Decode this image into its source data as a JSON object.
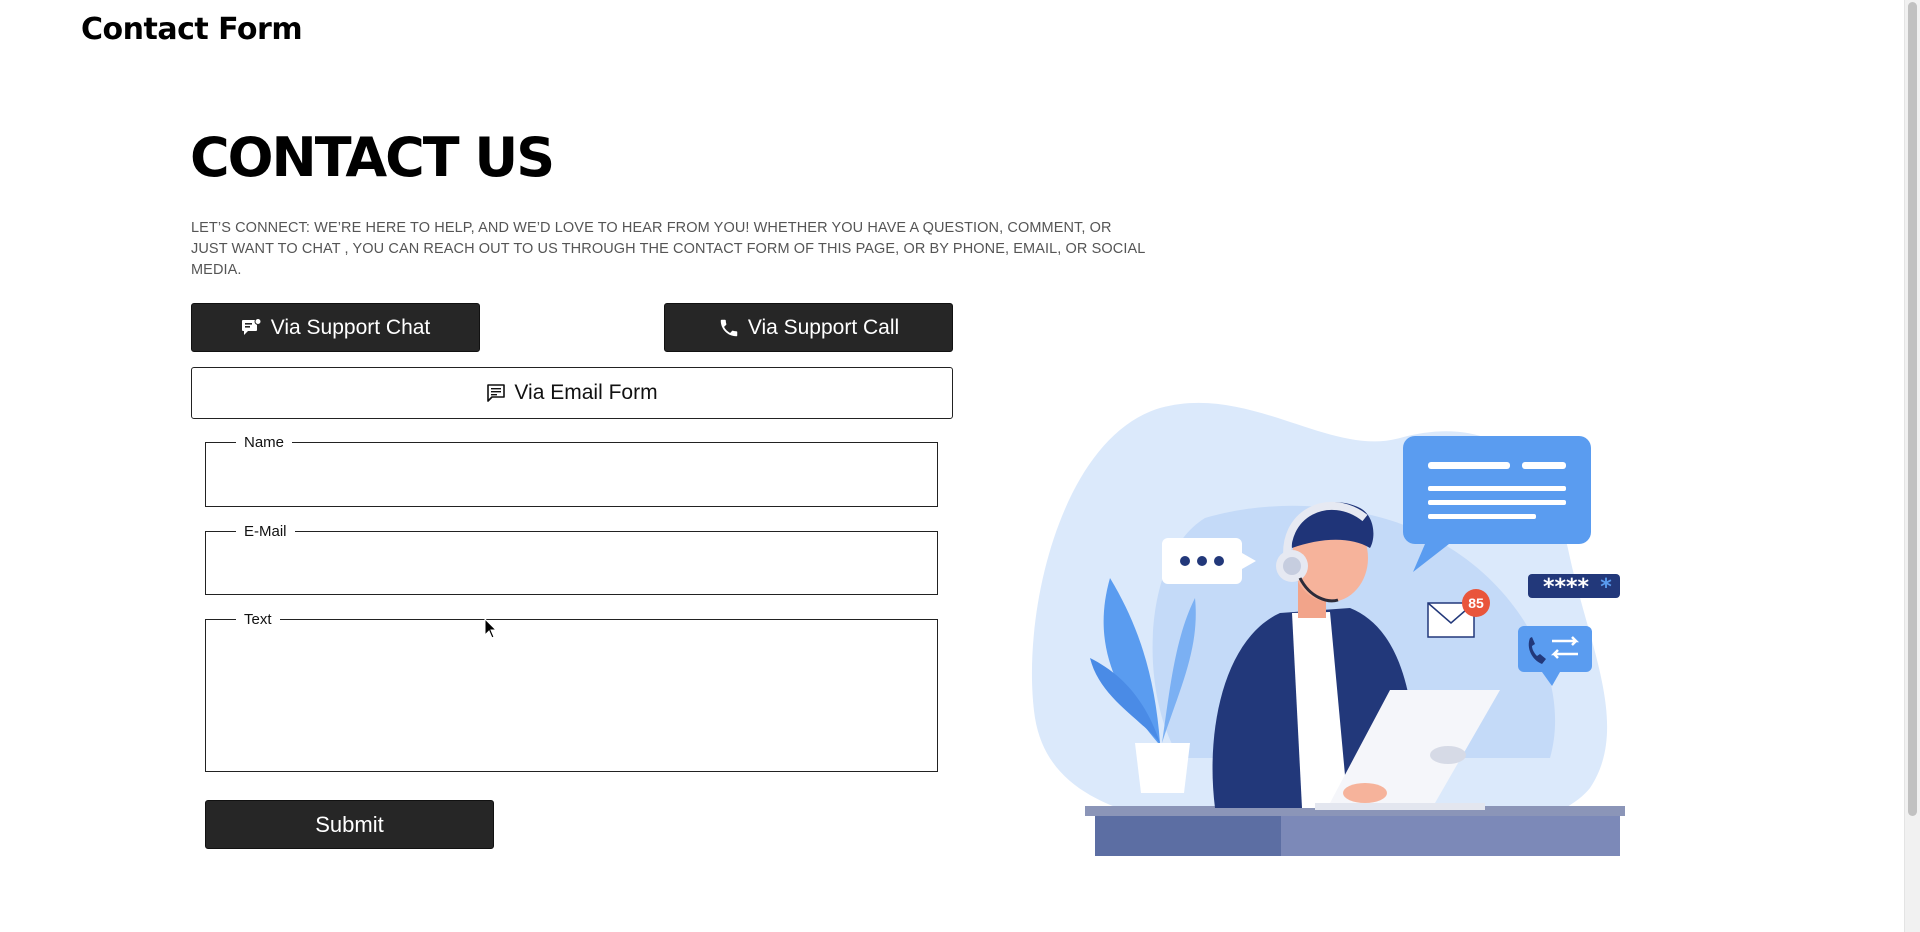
{
  "header": {
    "brand": "Contact Form"
  },
  "main": {
    "title": "CONTACT US",
    "intro": "LET’S CONNECT: WE’RE HERE TO HELP, AND WE’D LOVE TO HEAR FROM YOU! WHETHER YOU HAVE A QUESTION, COMMENT, OR JUST WANT TO CHAT , YOU CAN REACH OUT TO US THROUGH THE CONTACT FORM OF THIS PAGE, OR BY PHONE, EMAIL, OR SOCIAL MEDIA.",
    "buttons": {
      "chat": "Via Support Chat",
      "call": "Via Support Call",
      "email": "Via Email Form"
    }
  },
  "form": {
    "name_label": "Name",
    "name_value": "",
    "email_label": "E-Mail",
    "email_value": "",
    "text_label": "Text",
    "text_value": "",
    "submit_label": "Submit"
  },
  "illustration": {
    "notification_count": "85",
    "password_mask": "****"
  },
  "colors": {
    "button_dark": "#262626",
    "illustration_blue": "#5a9cf0",
    "illustration_navy": "#1f3478",
    "illustration_light": "#dbe9fb"
  }
}
